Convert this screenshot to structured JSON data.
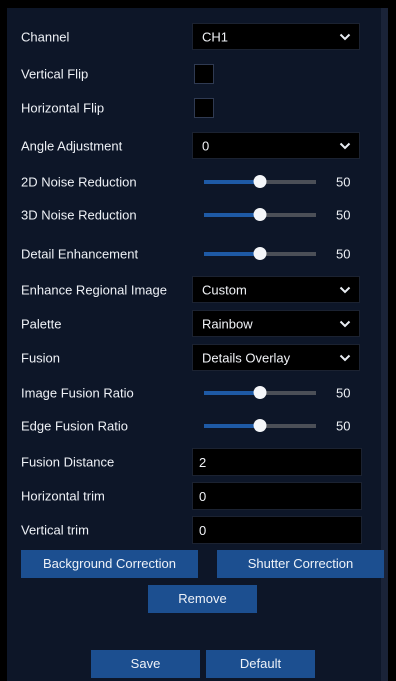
{
  "colors": {
    "panel": "#0d1628",
    "field": "#000000",
    "button": "#1c4f90",
    "slider_fill": "#1e5aa6",
    "slider_track": "#4b4f57",
    "text": "#eef1f6"
  },
  "icons": {
    "dropdown": "chevron-down-icon"
  },
  "form": {
    "channel": {
      "label": "Channel",
      "value": "CH1"
    },
    "vertical_flip": {
      "label": "Vertical Flip",
      "checked": false
    },
    "horizontal_flip": {
      "label": "Horizontal Flip",
      "checked": false
    },
    "angle_adjustment": {
      "label": "Angle Adjustment",
      "value": "0"
    },
    "noise_2d": {
      "label": "2D Noise Reduction",
      "value": 50,
      "min": 0,
      "max": 100,
      "display": "50"
    },
    "noise_3d": {
      "label": "3D Noise Reduction",
      "value": 50,
      "min": 0,
      "max": 100,
      "display": "50"
    },
    "detail_enhancement": {
      "label": "Detail Enhancement",
      "value": 50,
      "min": 0,
      "max": 100,
      "display": "50"
    },
    "enhance_regional_image": {
      "label": "Enhance Regional Image",
      "value": "Custom"
    },
    "palette": {
      "label": "Palette",
      "value": "Rainbow"
    },
    "fusion": {
      "label": "Fusion",
      "value": "Details Overlay"
    },
    "image_fusion_ratio": {
      "label": "Image Fusion Ratio",
      "value": 50,
      "min": 0,
      "max": 100,
      "display": "50"
    },
    "edge_fusion_ratio": {
      "label": "Edge Fusion Ratio",
      "value": 50,
      "min": 0,
      "max": 100,
      "display": "50"
    },
    "fusion_distance": {
      "label": "Fusion Distance",
      "value": "2"
    },
    "horizontal_trim": {
      "label": "Horizontal trim",
      "value": "0"
    },
    "vertical_trim": {
      "label": "Vertical trim",
      "value": "0"
    }
  },
  "buttons": {
    "background_correction": "Background Correction",
    "shutter_correction": "Shutter Correction",
    "remove": "Remove",
    "save": "Save",
    "default": "Default"
  }
}
